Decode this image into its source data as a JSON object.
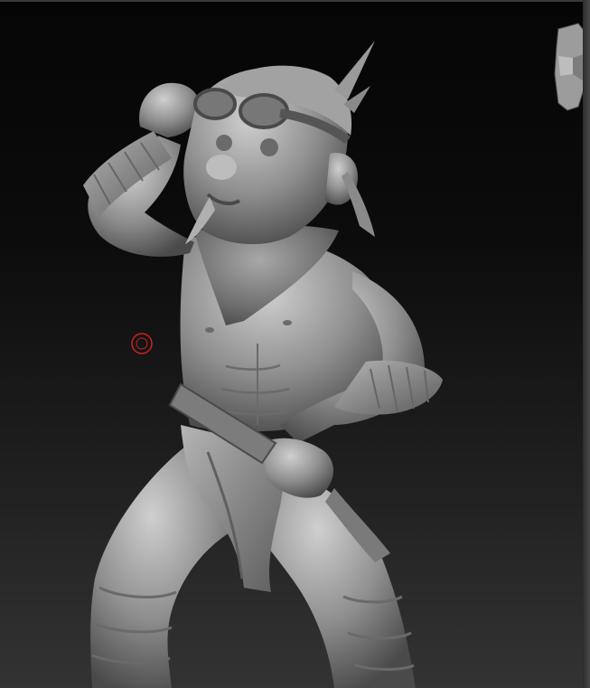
{
  "viewport": {
    "background_top": "#050505",
    "background_bottom": "#333333",
    "model_color": "#9a9a9a",
    "brush_cursor_color": "#cc2222"
  },
  "icons": {
    "brush_cursor": "brush-cursor-icon",
    "orientation_head": "head-orientation-icon"
  }
}
